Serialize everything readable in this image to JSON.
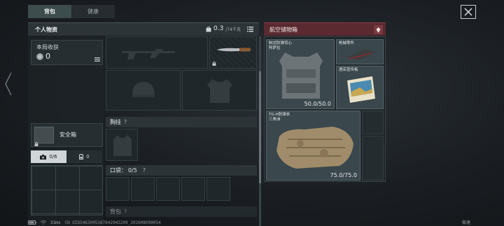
{
  "tabs": [
    {
      "label": "背包",
      "active": true
    },
    {
      "label": "健康",
      "active": false
    }
  ],
  "backpack": {
    "title": "个人物资",
    "weight_value": "0.3",
    "weight_unit": "/74千克"
  },
  "earnings": {
    "label": "本局收获",
    "value": "0"
  },
  "safe_box": {
    "label": "安全箱"
  },
  "subtabs": [
    {
      "icon": "first-aid-icon",
      "label": "0/6"
    },
    {
      "icon": "battery-icon",
      "label": "0"
    }
  ],
  "sections": {
    "chest_rig": "胸挂",
    "pockets": "口袋：",
    "pockets_count": "0/5",
    "backpack_slot": "背包",
    "help": "?"
  },
  "air_box": {
    "title": "航空储物箱",
    "items": [
      {
        "name": "制式防弹背心\n阿萨拉",
        "durability": "50.0/50.0"
      },
      {
        "name": "枪械零件",
        "durability": ""
      },
      {
        "name": "酒店宣传板",
        "durability": ""
      },
      {
        "name": "TG-H防弹衣\n三角洲",
        "durability": "75.0/75.0"
      }
    ]
  },
  "status_bar": {
    "ping": "33ms",
    "uid": "CN UID5463095187642942209_202608090054"
  },
  "corner_label": "极速",
  "colors": {
    "accent_red": "#5a2a30",
    "active_tab": "#3d4c4c"
  }
}
